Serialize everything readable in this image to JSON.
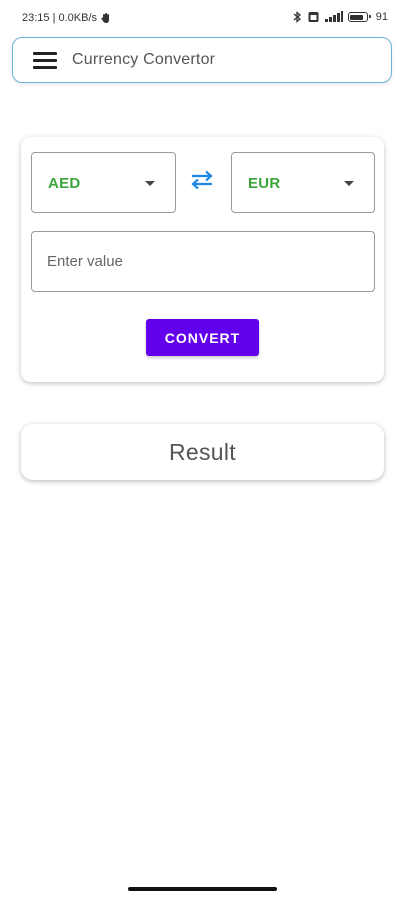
{
  "status_bar": {
    "time_speed": "23:15 | 0.0KB/s",
    "battery": "91"
  },
  "app_bar": {
    "title": "Currency Convertor",
    "menu_icon": "hamburger-menu-icon"
  },
  "converter": {
    "from_currency": "AED",
    "to_currency": "EUR",
    "swap_icon": "swap-arrows-icon",
    "value_input": {
      "value": "",
      "placeholder": "Enter value"
    },
    "convert_label": "CONVERT"
  },
  "result": {
    "label": "Result"
  },
  "colors": {
    "accent": "#6200ee",
    "currency_text": "#3aa53a",
    "swap_icon": "#1e88e5",
    "app_bar_border": "#6db3d6"
  }
}
